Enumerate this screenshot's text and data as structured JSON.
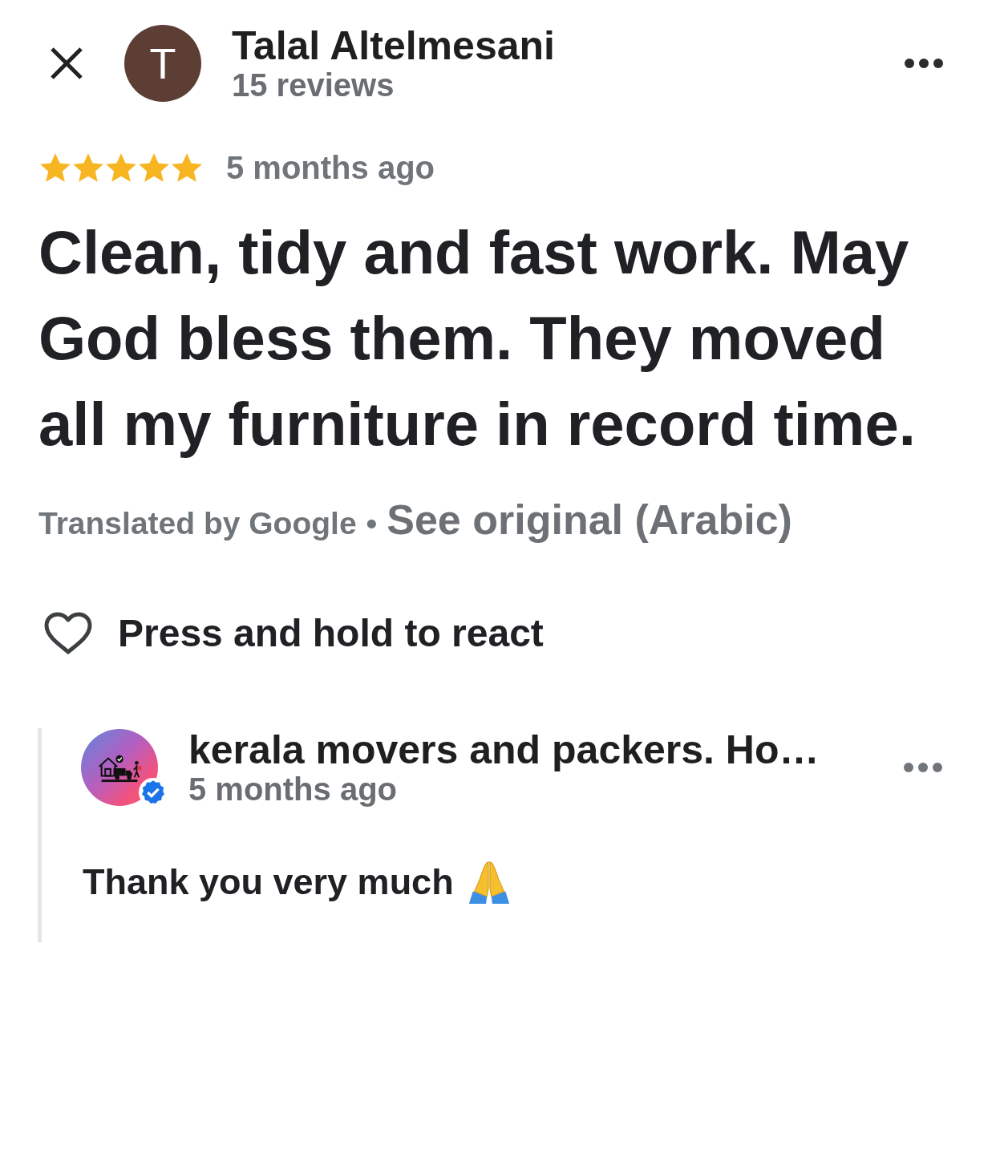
{
  "reviewer": {
    "initial": "T",
    "name": "Talal Altelmesani",
    "review_count": "15 reviews"
  },
  "review": {
    "stars": 5,
    "time": "5 months ago",
    "text": "Clean, tidy and fast work. May God bless them. They moved all my furniture in record time.",
    "translation_note": "Translated by Google",
    "separator": "•",
    "original_link": "See original (Arabic)"
  },
  "reaction": {
    "label": "Press and hold to react"
  },
  "owner_reply": {
    "name": "kerala movers and packers. Ho…",
    "verified": true,
    "time": "5 months ago",
    "text": "Thank you very much"
  }
}
